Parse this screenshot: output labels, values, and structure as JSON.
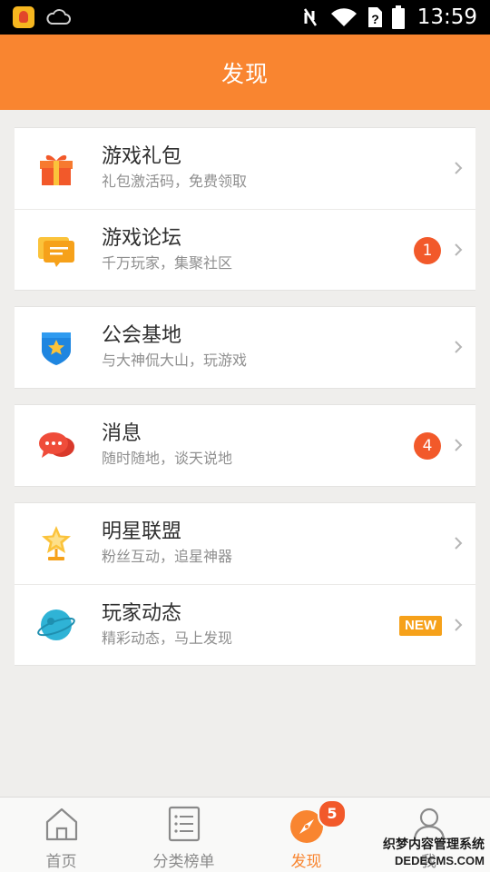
{
  "status_bar": {
    "time": "13:59"
  },
  "header": {
    "title": "发现"
  },
  "groups": [
    {
      "items": [
        {
          "title": "游戏礼包",
          "subtitle": "礼包激活码，免费领取",
          "icon": "gift-icon"
        },
        {
          "title": "游戏论坛",
          "subtitle": "千万玩家，集聚社区",
          "icon": "forum-icon",
          "badge": "1"
        }
      ]
    },
    {
      "items": [
        {
          "title": "公会基地",
          "subtitle": "与大神侃大山，玩游戏",
          "icon": "guild-shield-icon"
        }
      ]
    },
    {
      "items": [
        {
          "title": "消息",
          "subtitle": "随时随地，谈天说地",
          "icon": "message-bubble-icon",
          "badge": "4"
        }
      ]
    },
    {
      "items": [
        {
          "title": "明星联盟",
          "subtitle": "粉丝互动，追星神器",
          "icon": "star-trophy-icon"
        },
        {
          "title": "玩家动态",
          "subtitle": "精彩动态，马上发现",
          "icon": "planet-icon",
          "tag": "NEW"
        }
      ]
    }
  ],
  "bottom_nav": {
    "items": [
      {
        "label": "首页",
        "icon": "home-icon"
      },
      {
        "label": "分类榜单",
        "icon": "list-icon"
      },
      {
        "label": "发现",
        "icon": "compass-icon",
        "badge": "5",
        "active": true
      },
      {
        "label": "我",
        "icon": "user-icon"
      }
    ]
  },
  "watermark": {
    "line1": "织梦内容管理系统",
    "line2": "DEDECMS.COM"
  },
  "colors": {
    "accent": "#f98530",
    "badge": "#f2592a",
    "new_tag": "#f6a11a"
  }
}
